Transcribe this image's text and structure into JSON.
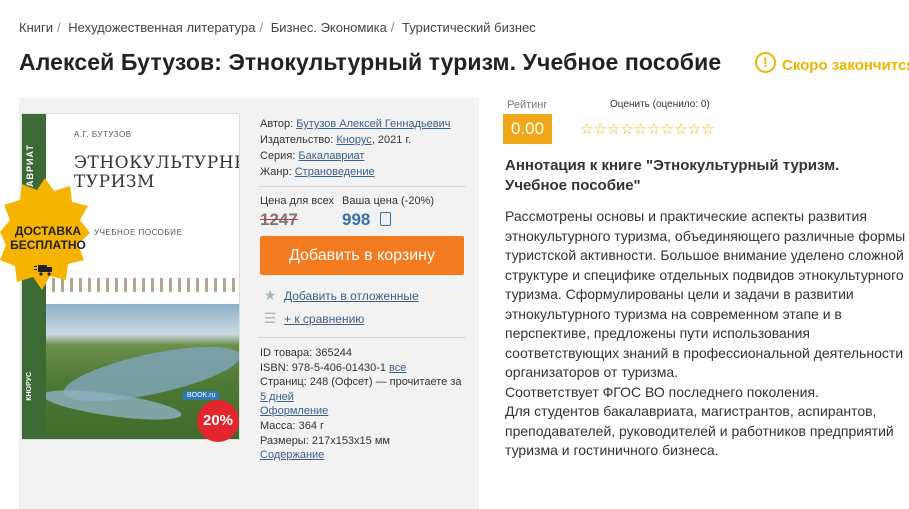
{
  "breadcrumb": {
    "items": [
      "Книги",
      "Нехудожественная литература",
      "Бизнес. Экономика",
      "Туристический бизнес"
    ],
    "separator": "/"
  },
  "book": {
    "title": "Алексей Бутузов: Этнокультурный туризм. Учебное пособие",
    "status": "Скоро закончится",
    "status_icon": "!"
  },
  "cover": {
    "author": "А.Г. БУТУЗОВ",
    "title_line1": "ЭТНОКУЛЬТУРНЫЙ",
    "title_line2": "ТУРИЗМ",
    "subtitle": "УЧЕБНОЕ ПОСОБИЕ",
    "spine": "БАКАЛАВРИАТ",
    "publisher": "КНОРУС",
    "brand": "BOOK.ru"
  },
  "delivery_badge": {
    "line1": "ДОСТАВКА",
    "line2": "БЕСПЛАТНО",
    "icon": "truck-icon",
    "color": "#f6b400"
  },
  "discount_badge": "20%",
  "meta": {
    "author_label": "Автор:",
    "author_value": "Бутузов Алексей Геннадьевич",
    "publisher_label": "Издательство:",
    "publisher_value": "Кнорус",
    "publisher_year": ", 2021 г.",
    "series_label": "Серия:",
    "series_value": "Бакалавриат",
    "genre_label": "Жанр:",
    "genre_value": "Страноведение"
  },
  "price": {
    "all_label": "Цена для всех",
    "your_label": "Ваша цена (-20%)",
    "old": "1247",
    "new": "998",
    "currency_icon": "ruble-icon"
  },
  "actions": {
    "add_to_cart": "Добавить в корзину",
    "wishlist": "Добавить в отложенные",
    "compare": "+ к сравнению"
  },
  "details": {
    "id_label": "ID товара:",
    "id_value": "365244",
    "isbn_label": "ISBN:",
    "isbn_value": "978-5-406-01430-1",
    "isbn_all": "все",
    "pages_label": "Страниц:",
    "pages_value": "248 (Офсет)",
    "read_prefix": "— прочитаете за",
    "read_days": "5 дней",
    "design": "Оформление",
    "mass_label": "Масса:",
    "mass_value": "364 г",
    "size_label": "Размеры:",
    "size_value": "217x153x15 мм",
    "contents": "Содержание"
  },
  "rating": {
    "label": "Рейтинг",
    "value": "0.00",
    "rate_label": "Оценить (оценило: 0)",
    "stars": "☆☆☆☆☆☆☆☆☆☆"
  },
  "annotation": {
    "title": "Аннотация к книге \"Этнокультурный туризм. Учебное пособие\"",
    "body": "Рассмотрены основы и практические аспекты развития этнокультурного туризма, объединяющего различные формы туристской активности. Большое внимание уделено сложной структуре и специфике отдельных подвидов этнокультурного туризма. Сформулированы цели и задачи в развитии этнокультурного туризма на современном этапе и в перспективе, предложены пути использования соответствующих знаний в профессиональной деятельности организаторов от туризма.\nСоответствует ФГОС ВО последнего поколения.\nДля студентов бакалавриата, магистрантов, аспирантов, преподавателей, руководителей и работников предприятий туризма и гостиничного бизнеса."
  },
  "colors": {
    "accent_orange": "#f47a20",
    "rating_orange": "#f0a81a",
    "link_blue": "#3a5f8a",
    "price_blue": "#3a6ea5",
    "sale_red": "#e3262e",
    "warning_yellow": "#f0b400"
  }
}
